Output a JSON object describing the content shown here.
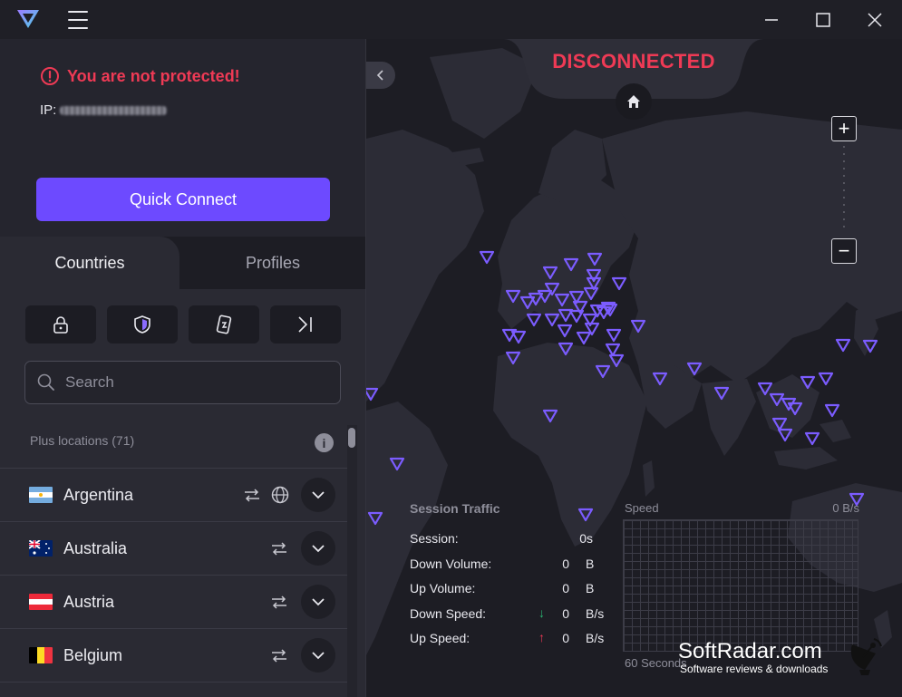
{
  "titlebar": {
    "logo_icon": "protonvpn-logo-icon",
    "menu_icon": "hamburger-menu-icon"
  },
  "status": {
    "warning": "You are not protected!",
    "ip_label": "IP:",
    "connection": "DISCONNECTED"
  },
  "sidebar": {
    "quick_connect": "Quick Connect",
    "tabs": [
      {
        "label": "Countries",
        "active": true
      },
      {
        "label": "Profiles",
        "active": false
      }
    ],
    "filters": [
      {
        "icon": "lock-icon"
      },
      {
        "icon": "shield-icon"
      },
      {
        "icon": "phone-icon"
      },
      {
        "icon": "arrow-bar-icon"
      }
    ],
    "search_placeholder": "Search",
    "section_label": "Plus locations (71)",
    "countries": [
      {
        "name": "Argentina",
        "p2p": true,
        "tor": true
      },
      {
        "name": "Australia",
        "p2p": true,
        "tor": false
      },
      {
        "name": "Austria",
        "p2p": true,
        "tor": false
      },
      {
        "name": "Belgium",
        "p2p": true,
        "tor": false
      }
    ]
  },
  "traffic": {
    "title": "Session Traffic",
    "session_label": "Session:",
    "session_value": "0s",
    "down_volume_label": "Down Volume:",
    "down_volume_value": "0",
    "down_volume_unit": "B",
    "up_volume_label": "Up Volume:",
    "up_volume_value": "0",
    "up_volume_unit": "B",
    "down_speed_label": "Down Speed:",
    "down_speed_arrow": "↓",
    "down_speed_value": "0",
    "down_speed_unit": "B/s",
    "up_speed_label": "Up Speed:",
    "up_speed_arrow": "↑",
    "up_speed_value": "0",
    "up_speed_unit": "B/s"
  },
  "speed_chart": {
    "label": "Speed",
    "value": "0 B/s",
    "footer": "60 Seconds"
  },
  "map": {
    "zoom_in": "+",
    "zoom_out": "−"
  },
  "watermark": {
    "title": "SoftRadar.com",
    "subtitle": "Software reviews & downloads"
  },
  "colors": {
    "accent": "#6d4aff",
    "danger": "#ef3a55",
    "marker": "#7b5cff",
    "down_arrow": "#2bb673",
    "up_arrow": "#ef3a55"
  }
}
